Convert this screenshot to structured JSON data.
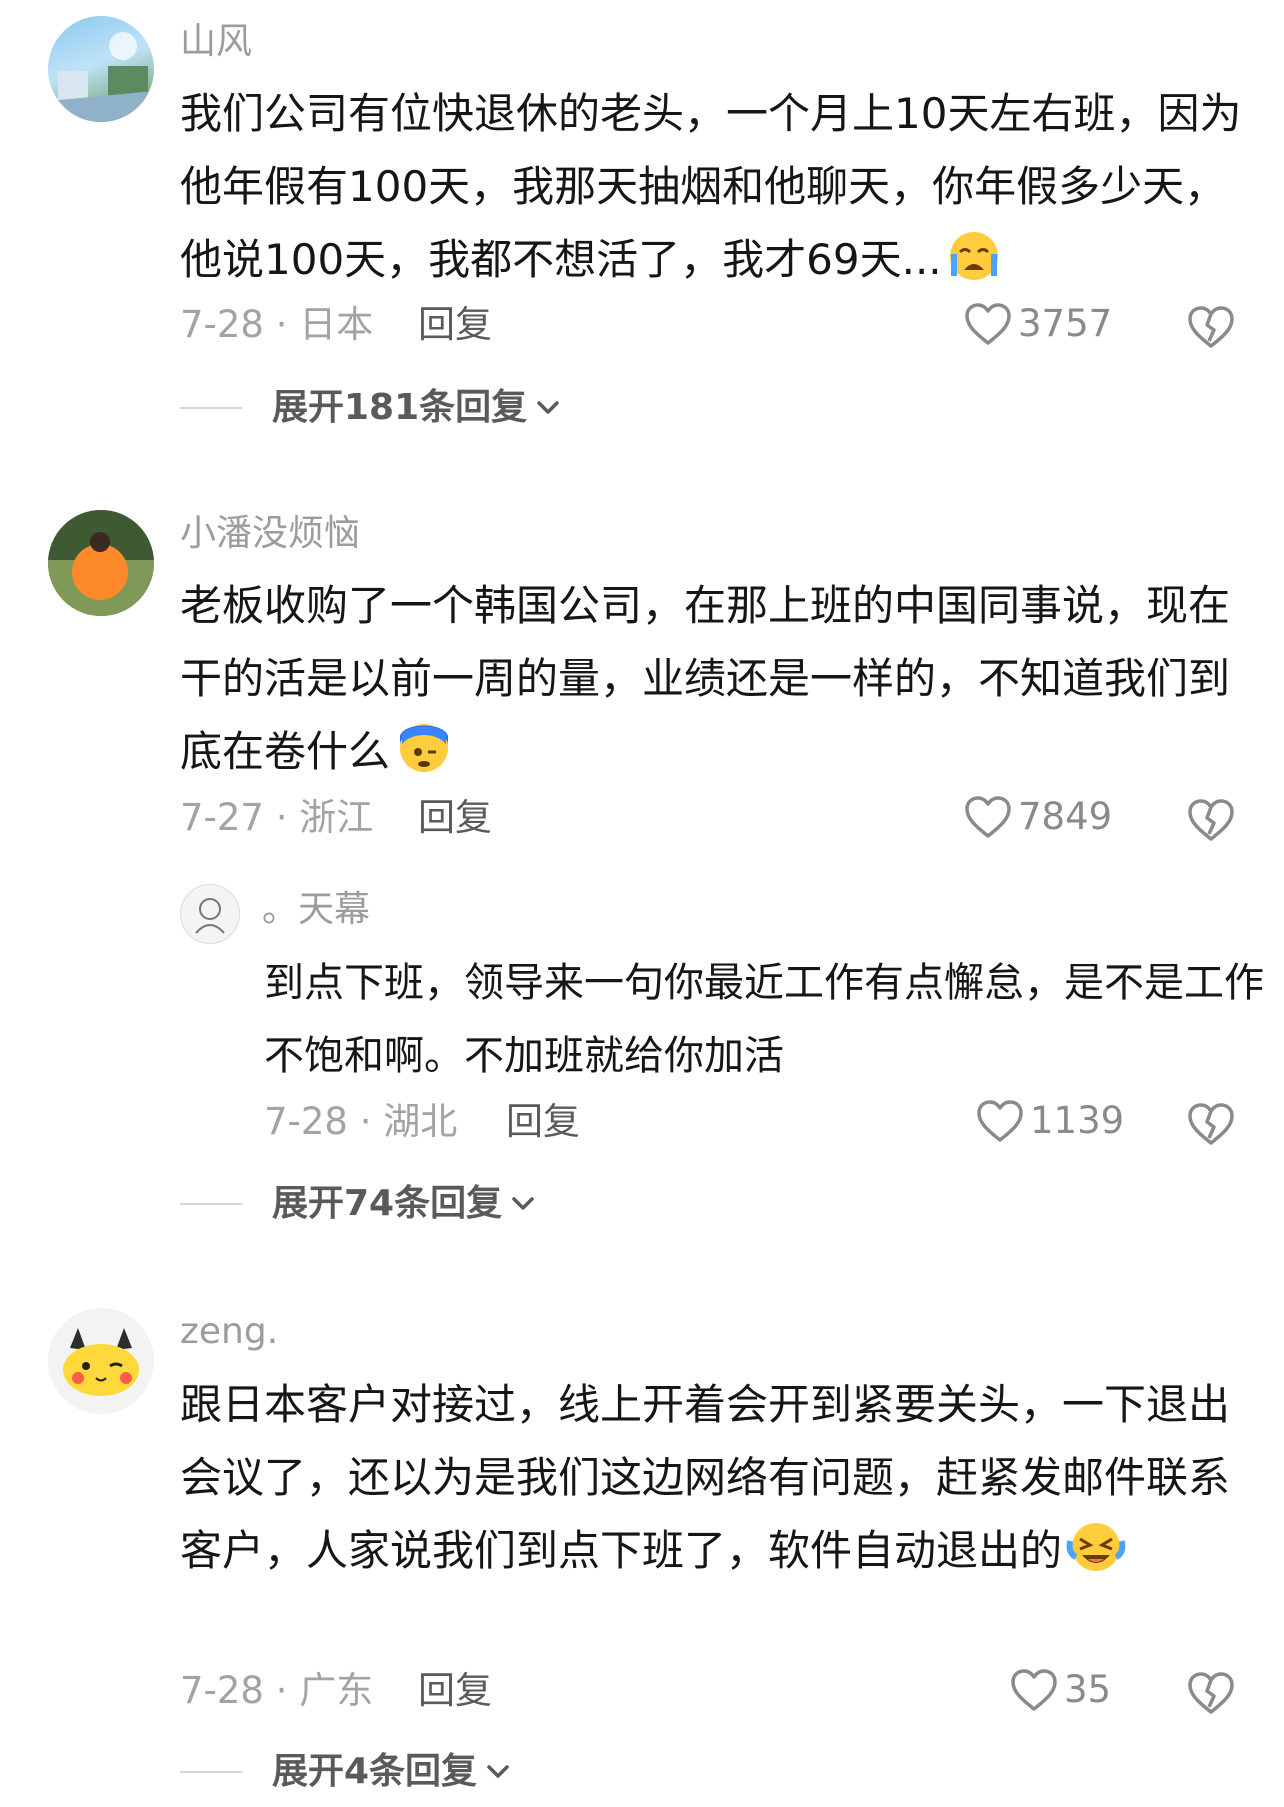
{
  "comments": [
    {
      "name": "山风",
      "text": "我们公司有位快退休的老头，一个月上10天左右班，因为他年假有100天，我那天抽烟和他聊天，你年假多少天，他说100天，我都不想活了，我才69天...",
      "emoji": "crying-face-emoji",
      "date_location": "7-28 · 日本",
      "reply_label": "回复",
      "likes": "3757",
      "expand_label": "展开181条回复"
    },
    {
      "name": "小潘没烦恼",
      "text": "老板收购了一个韩国公司，在那上班的中国同事说，现在干的活是以前一周的量，业绩还是一样的，不知道我们到底在卷什么",
      "emoji": "stressed-face-emoji",
      "date_location": "7-27 · 浙江",
      "reply_label": "回复",
      "likes": "7849",
      "reply": {
        "name": "。天幕",
        "text": "到点下班，领导来一句你最近工作有点懈怠，是不是工作不饱和啊。不加班就给你加活",
        "date_location": "7-28 · 湖北",
        "reply_label": "回复",
        "likes": "1139"
      },
      "expand_label": "展开74条回复"
    },
    {
      "name": "zeng.",
      "text": "跟日本客户对接过，线上开着会开到紧要关头，一下退出会议了，还以为是我们这边网络有问题，赶紧发邮件联系客户，人家说我们到点下班了，软件自动退出的",
      "emoji": "laughing-tears-emoji",
      "date_location": "7-28 · 广东",
      "reply_label": "回复",
      "likes": "35",
      "expand_label": "展开4条回复"
    }
  ],
  "colors": {
    "text": "#161616",
    "meta": "#a3a3a3",
    "name": "#9c9c9c",
    "reply_button": "#5a5a5a"
  }
}
